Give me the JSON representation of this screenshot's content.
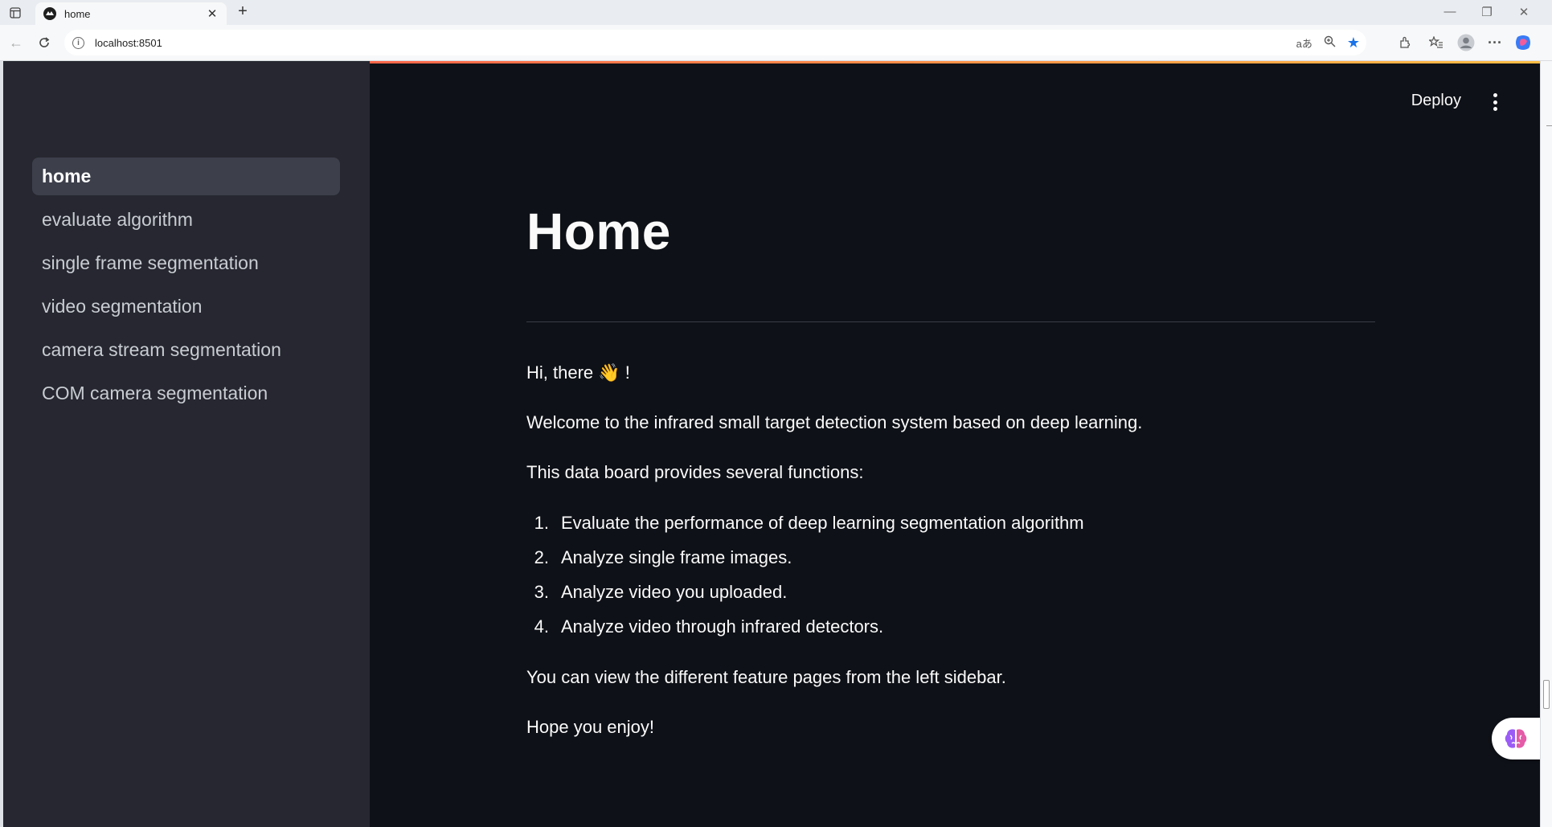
{
  "browser": {
    "tab_title": "home",
    "url": "localhost:8501"
  },
  "header": {
    "deploy_label": "Deploy"
  },
  "sidebar": {
    "items": [
      {
        "label": "home",
        "active": true
      },
      {
        "label": "evaluate algorithm",
        "active": false
      },
      {
        "label": "single frame segmentation",
        "active": false
      },
      {
        "label": "video segmentation",
        "active": false
      },
      {
        "label": "camera stream segmentation",
        "active": false
      },
      {
        "label": "COM camera segmentation",
        "active": false
      }
    ]
  },
  "main": {
    "title": "Home",
    "greeting": "Hi, there 👋 !",
    "welcome": "Welcome to the infrared small target detection system based on deep learning.",
    "intro": "This data board provides several functions:",
    "functions": [
      {
        "num": "1.",
        "text": "Evaluate the performance of deep learning segmentation algorithm"
      },
      {
        "num": "2.",
        "text": "Analyze single frame images."
      },
      {
        "num": "3.",
        "text": "Analyze video you uploaded."
      },
      {
        "num": "4.",
        "text": "Analyze video through infrared detectors."
      }
    ],
    "sidebar_hint": "You can view the different feature pages from the left sidebar.",
    "closing": "Hope you enjoy!"
  },
  "colors": {
    "app_background": "#0e1117",
    "sidebar_background": "#262730",
    "active_item_background": "#3d3f4b",
    "accent_gradient_start": "#ff4b4b",
    "accent_gradient_end": "#ffbd45"
  }
}
